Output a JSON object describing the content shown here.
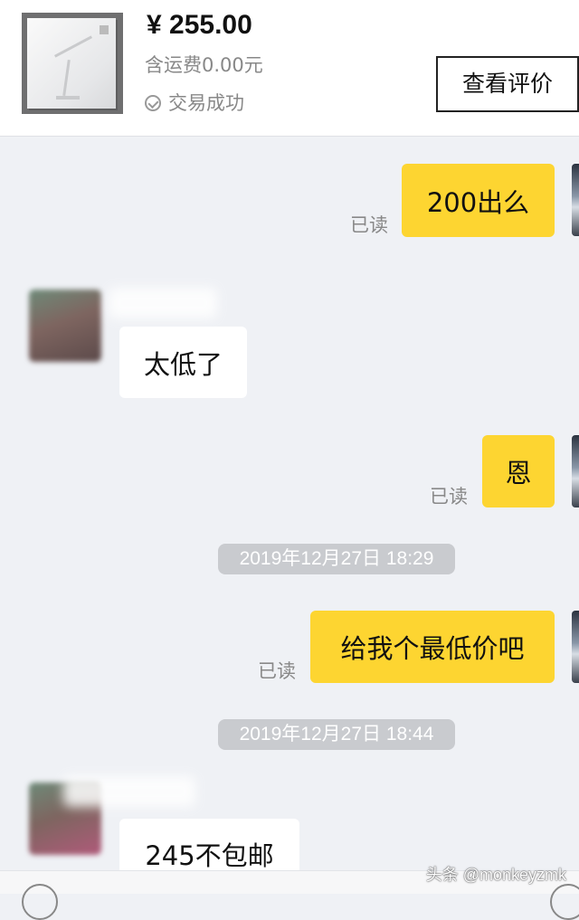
{
  "product": {
    "price": "¥ 255.00",
    "shipping": "含运费0.00元",
    "status": "交易成功",
    "review_button": "查看评价",
    "status_icon": "check-circle-icon"
  },
  "messages": [
    {
      "side": "mine",
      "text": "200出么",
      "read": "已读"
    },
    {
      "side": "theirs",
      "text": "太低了"
    },
    {
      "side": "mine",
      "text": "恩",
      "read": "已读"
    },
    {
      "type": "timestamp",
      "text": "2019年12月27日 18:29"
    },
    {
      "side": "mine",
      "text": "给我个最低价吧",
      "read": "已读"
    },
    {
      "type": "timestamp",
      "text": "2019年12月27日 18:44"
    },
    {
      "side": "theirs",
      "text": "245不包邮"
    }
  ],
  "watermark": "头条 @monkeyzmk",
  "colors": {
    "mine_bubble": "#fdd531",
    "theirs_bubble": "#ffffff",
    "chat_background": "#eff1f5",
    "timestamp_pill": "#c9cbcf"
  }
}
